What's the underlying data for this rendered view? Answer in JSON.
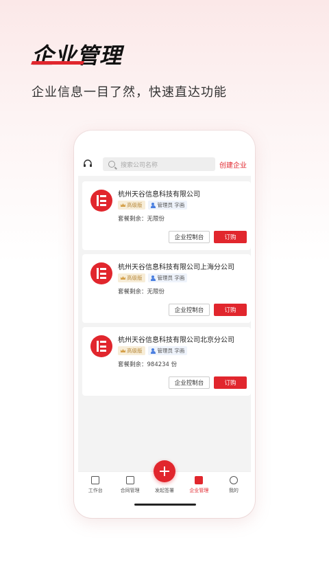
{
  "promo": {
    "title": "企业管理",
    "subtitle": "企业信息一目了然，快速直达功能"
  },
  "topbar": {
    "search_placeholder": "搜索公司名称",
    "create_label": "创建企业"
  },
  "companies": [
    {
      "name": "杭州天谷信息科技有限公司",
      "level": "高级版",
      "admin": "管理员 字画",
      "quota_label": "套餐剩余：",
      "quota_value": "无限份",
      "console_label": "企业控制台",
      "order_label": "订购"
    },
    {
      "name": "杭州天谷信息科技有限公司上海分公司",
      "level": "高级版",
      "admin": "管理员 字画",
      "quota_label": "套餐剩余：",
      "quota_value": "无限份",
      "console_label": "企业控制台",
      "order_label": "订购"
    },
    {
      "name": "杭州天谷信息科技有限公司北京分公司",
      "level": "高级版",
      "admin": "管理员 字画",
      "quota_label": "套餐剩余：",
      "quota_value": "984234 份",
      "console_label": "企业控制台",
      "order_label": "订购"
    }
  ],
  "tabbar": {
    "items": [
      {
        "label": "工作台",
        "icon": "workbench-icon"
      },
      {
        "label": "合同管理",
        "icon": "contract-icon"
      },
      {
        "label": "发起签署",
        "icon": "plus-icon"
      },
      {
        "label": "企业管理",
        "icon": "enterprise-icon",
        "active": true
      },
      {
        "label": "我的",
        "icon": "profile-icon"
      }
    ]
  },
  "colors": {
    "accent": "#e1262d",
    "gold": "#b88a3c"
  }
}
